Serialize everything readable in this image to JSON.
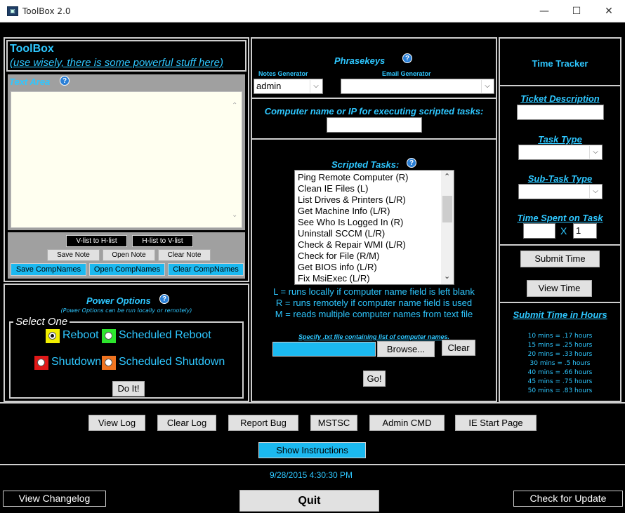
{
  "window": {
    "title": "ToolBox 2.0",
    "app_icon": "toolbox-icon",
    "min": "—",
    "max": "☐",
    "close": "✕"
  },
  "left": {
    "title": "ToolBox",
    "subtitle": "(use wisely, there is some powerful stuff here)",
    "text_area_label": "Text Area",
    "text_area_value": "",
    "buttons": {
      "v_to_h": "V-list to H-list",
      "h_to_v": "H-list to V-list",
      "save_note": "Save Note",
      "open_note": "Open Note",
      "clear_note": "Clear Note",
      "save_comp": "Save CompNames",
      "open_comp": "Open CompNames",
      "clear_comp": "Clear CompNames"
    },
    "power": {
      "title": "Power Options",
      "subtitle": "(Power Options can be run locally or remotely)",
      "group": "Select One",
      "reboot": "Reboot",
      "sched_reboot": "Scheduled Reboot",
      "shutdown": "Shutdown",
      "sched_shutdown": "Scheduled Shutdown",
      "selected": "Reboot",
      "doit": "Do It!",
      "colors": {
        "reboot": "#f2ef00",
        "sched_reboot": "#2de52d",
        "shutdown": "#e01818",
        "sched_shutdown": "#f07420"
      }
    }
  },
  "middle": {
    "phrasekeys": "Phrasekeys",
    "notes_gen_label": "Notes Generator",
    "notes_gen_value": "admin",
    "email_gen_label": "Email Generator",
    "email_gen_value": "",
    "computer_label": "Computer name or IP for executing scripted tasks:",
    "computer_value": "",
    "scripted_label": "Scripted Tasks:",
    "tasks": [
      "Ping Remote Computer (R)",
      "Clean IE Files (L)",
      "List Drives & Printers (L/R)",
      "Get Machine Info (L/R)",
      "See Who Is Logged In (R)",
      "Uninstall SCCM (L/R)",
      "Check & Repair WMI (L/R)",
      "Check for File (R/M)",
      "Get BIOS info (L/R)",
      "Fix MsiExec (L/R)"
    ],
    "legend": [
      "L = runs locally if computer name field is left blank",
      "R = runs remotely if computer name field is used",
      "M = reads multiple computer names from text file"
    ],
    "file_label": "Specify .txt file containing list of computer names.",
    "file_value": "",
    "browse": "Browse...",
    "clear": "Clear",
    "go": "Go!"
  },
  "right": {
    "title": "Time Tracker",
    "ticket_label": "Ticket Description",
    "ticket_value": "",
    "task_type_label": "Task Type",
    "task_type_value": "",
    "subtask_label": "Sub-Task Type",
    "subtask_value": "",
    "time_spent_label": "Time Spent on Task",
    "time_value": "",
    "x": "X",
    "multiplier": "1",
    "submit": "Submit Time",
    "view": "View Time",
    "hours_label": "Submit Time in Hours",
    "conversions": [
      "10 mins = .17 hours",
      "15 mins = .25 hours",
      "20 mins = .33 hours",
      "30 mins = .5 hours",
      "40 mins = .66 hours",
      "45 mins = .75 hours",
      "50 mins = .83 hours"
    ]
  },
  "bottom": {
    "view_log": "View Log",
    "clear_log": "Clear Log",
    "report_bug": "Report Bug",
    "mstsc": "MSTSC",
    "admin_cmd": "Admin CMD",
    "ie_start": "IE Start Page",
    "show_instructions": "Show Instructions",
    "datetime": "9/28/2015 4:30:30 PM",
    "view_changelog": "View Changelog",
    "quit": "Quit",
    "check_update": "Check for Update"
  },
  "colors": {
    "accent": "#2ec7ff",
    "background": "#000000",
    "text_area_bg": "#fffff0",
    "cyan_button": "#1bb9f0"
  }
}
